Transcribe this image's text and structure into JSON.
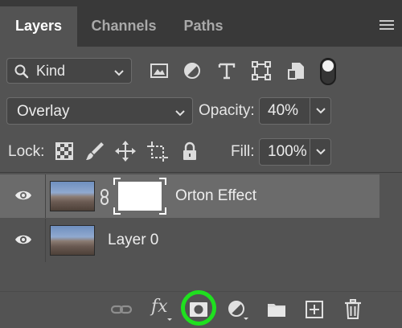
{
  "tabs": [
    {
      "label": "Layers",
      "active": true
    },
    {
      "label": "Channels",
      "active": false
    },
    {
      "label": "Paths",
      "active": false
    }
  ],
  "panel_menu_icon": "hamburger-menu-icon",
  "filter": {
    "type_value": "Kind",
    "icons": [
      "image-filter-icon",
      "adjustment-filter-icon",
      "type-filter-icon",
      "shape-filter-icon",
      "smart-object-filter-icon"
    ],
    "toggle_on": true
  },
  "blend": {
    "mode": "Overlay",
    "opacity_label": "Opacity:",
    "opacity_value": "40%"
  },
  "lock": {
    "label": "Lock:",
    "icons": [
      "lock-transparent-pixels-icon",
      "lock-image-pixels-icon",
      "lock-position-icon",
      "lock-artboard-icon",
      "lock-all-icon"
    ],
    "fill_label": "Fill:",
    "fill_value": "100%"
  },
  "layers": [
    {
      "name": "Orton Effect",
      "visible": true,
      "selected": true,
      "has_mask": true
    },
    {
      "name": "Layer 0",
      "visible": true,
      "selected": false,
      "has_mask": false
    }
  ],
  "bottom_toolbar": {
    "fx_label": "fx",
    "icons": [
      "link-layers-icon",
      "layer-style-fx-icon",
      "add-layer-mask-icon",
      "new-adjustment-layer-icon",
      "new-group-icon",
      "new-layer-icon",
      "delete-layer-icon"
    ],
    "highlighted": "add-layer-mask-icon"
  },
  "colors": {
    "panel_bg": "#535353",
    "tab_bar_bg": "#393939",
    "selected_row": "#6b6b6b",
    "highlight_ring": "#1fe01f"
  }
}
